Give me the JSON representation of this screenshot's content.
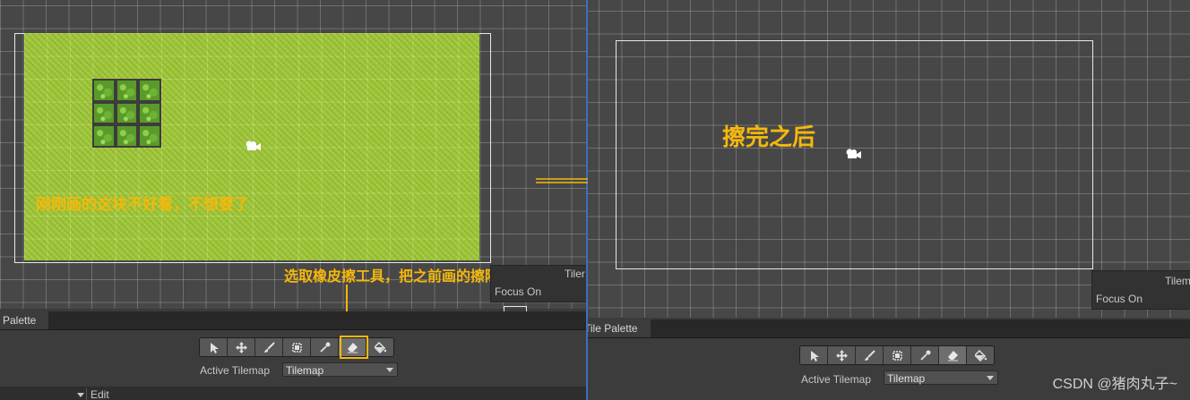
{
  "left": {
    "annotation_main": "刚刚画的这块不好看，不想要了",
    "annotation_tool": "选取橡皮擦工具，把之前画的擦除了",
    "overlay_title": "Tiler",
    "focus_label": "Focus On",
    "panel_tab": "Palette",
    "active_tilemap_label": "Active Tilemap",
    "active_tilemap_value": "Tilemap",
    "edit_label": "Edit"
  },
  "right": {
    "annotation": "擦完之后",
    "overlay_title": "Tilem",
    "focus_label": "Focus On",
    "panel_tab": "Tile Palette",
    "active_tilemap_label": "Active Tilemap",
    "active_tilemap_value": "Tilemap"
  },
  "tools": [
    {
      "name": "select-tool",
      "icon": "arrow-icon"
    },
    {
      "name": "move-tool",
      "icon": "move-icon"
    },
    {
      "name": "paint-tool",
      "icon": "brush-icon"
    },
    {
      "name": "box-fill-tool",
      "icon": "box-icon"
    },
    {
      "name": "picker-tool",
      "icon": "eyedropper-icon"
    },
    {
      "name": "eraser-tool",
      "icon": "eraser-icon",
      "active": true
    },
    {
      "name": "fill-tool",
      "icon": "bucket-icon"
    }
  ],
  "watermark": "CSDN @猪肉丸子~",
  "colors": {
    "annotation": "#f5b80c",
    "grass": "#9fc63d",
    "scene": "#474747",
    "selection_blue": "#3a71b8"
  }
}
